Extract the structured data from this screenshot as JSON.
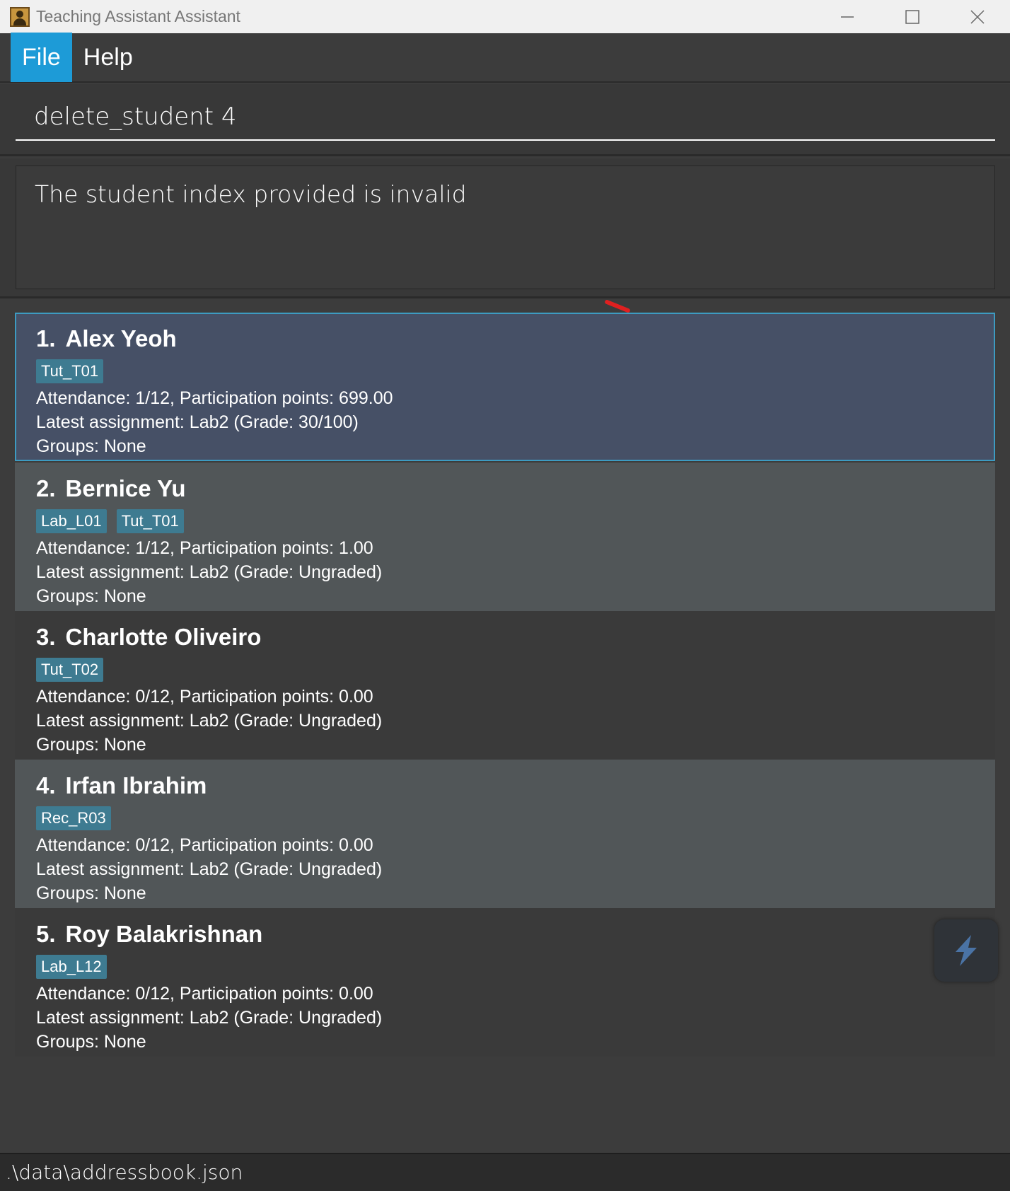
{
  "window": {
    "title": "Teaching Assistant Assistant"
  },
  "menu": {
    "file": "File",
    "help": "Help"
  },
  "command": {
    "value": "delete_student 4"
  },
  "result": {
    "message": "The student index provided is invalid"
  },
  "students": [
    {
      "index": "1.",
      "name": "Alex Yeoh",
      "tags": [
        "Tut_T01"
      ],
      "attendance": "Attendance: 1/12, Participation points: 699.00",
      "assignment": "Latest assignment: Lab2 (Grade: 30/100)",
      "groups": "Groups: None"
    },
    {
      "index": "2.",
      "name": "Bernice Yu",
      "tags": [
        "Lab_L01",
        "Tut_T01"
      ],
      "attendance": "Attendance: 1/12, Participation points: 1.00",
      "assignment": "Latest assignment: Lab2 (Grade: Ungraded)",
      "groups": "Groups: None"
    },
    {
      "index": "3.",
      "name": "Charlotte Oliveiro",
      "tags": [
        "Tut_T02"
      ],
      "attendance": "Attendance: 0/12, Participation points: 0.00",
      "assignment": "Latest assignment: Lab2 (Grade: Ungraded)",
      "groups": "Groups: None"
    },
    {
      "index": "4.",
      "name": "Irfan Ibrahim",
      "tags": [
        "Rec_R03"
      ],
      "attendance": "Attendance: 0/12, Participation points: 0.00",
      "assignment": "Latest assignment: Lab2 (Grade: Ungraded)",
      "groups": "Groups: None"
    },
    {
      "index": "5.",
      "name": "Roy Balakrishnan",
      "tags": [
        "Lab_L12"
      ],
      "attendance": "Attendance: 0/12, Participation points: 0.00",
      "assignment": "Latest assignment: Lab2 (Grade: Ungraded)",
      "groups": "Groups: None"
    }
  ],
  "status": {
    "path": ".\\data\\addressbook.json"
  },
  "colors": {
    "accent": "#1d9bd7",
    "tag": "#3e7b91",
    "selected_card": "#465066",
    "selected_border": "#3d9bc1",
    "card_light": "#515658",
    "card_dark": "#3a3a3a"
  }
}
